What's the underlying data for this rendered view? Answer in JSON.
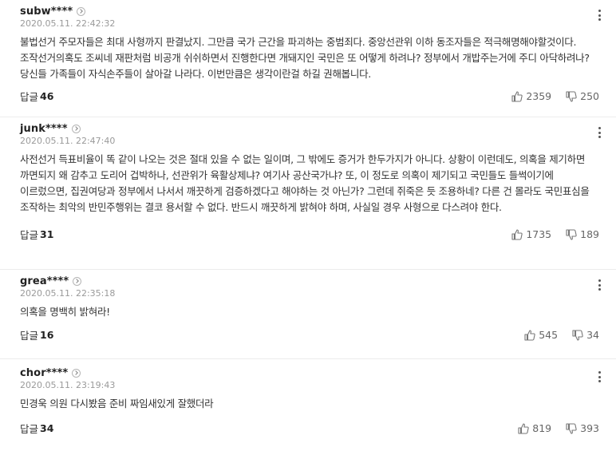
{
  "comments": [
    {
      "nickname": "subw****",
      "date": "2020.05.11. 22:42:32",
      "text": "불법선거 주모자들은 최대 사형까지 판결났지. 그만큼 국가 근간을 파괴하는 중범죄다. 중앙선관위 이하 동조자들은 적극해명해야할것이다. 조작선거의혹도 조씨네 재판처럼 비공개 쉬쉬하면서 진행한다면 개돼지인 국민은 또 어떻게 하려나? 정부에서 개밥주는거에 주디 아닥하려나? 당신들 가족들이 자식손주들이 살아갈 나라다. 이번만큼은 생각이란걸 하길 권해봅니다.",
      "reply_label": "답글",
      "reply_count": "46",
      "likes": "2359",
      "dislikes": "250"
    },
    {
      "nickname": "junk****",
      "date": "2020.05.11. 22:47:40",
      "text": "사전선거 득표비율이 똑 같이 나오는 것은 절대 있을 수 없는 일이며, 그 밖에도 증거가 한두가지가 아니다. 상황이 이런데도, 의혹을 제기하면 까면되지 왜 감추고 도리어 겁박하나, 선관위가 육활상제냐? 여기사 공산국가냐? 또, 이 정도로 의혹이 제기되고 국민들도 들썩이기에 이르렀으면, 집권여당과 정부에서 나서서 깨끗하게 검증하겠다고 해야하는 것 아닌가? 그런데 쥐죽은 듯 조용하네? 다른 건 몰라도 국민표심을 조작하는 최악의 반민주행위는 결코 용서할 수 없다. 반드시 깨끗하게 밝혀야 하며, 사실일 경우 사형으로 다스려야 한다.",
      "reply_label": "답글",
      "reply_count": "31",
      "likes": "1735",
      "dislikes": "189"
    },
    {
      "nickname": "grea****",
      "date": "2020.05.11. 22:35:18",
      "text": "의혹을 명백히 밝혀라!",
      "reply_label": "답글",
      "reply_count": "16",
      "likes": "545",
      "dislikes": "34"
    },
    {
      "nickname": "chor****",
      "date": "2020.05.11. 23:19:43",
      "text": "민경욱 의원 다시봤음 준비 짜임새있게 잘했더라",
      "reply_label": "답글",
      "reply_count": "34",
      "likes": "819",
      "dislikes": "393"
    }
  ],
  "icons": {
    "like": "thumbs-up-icon",
    "dislike": "thumbs-down-icon",
    "more": "kebab-menu-icon",
    "profile": "chevron-right-circle-icon"
  }
}
